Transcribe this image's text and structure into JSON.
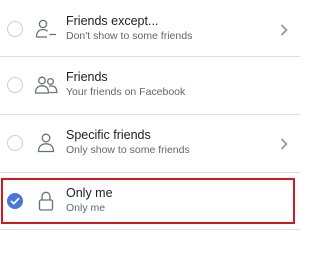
{
  "options": [
    {
      "title": "Friends except...",
      "subtitle": "Don't show to some friends",
      "selected": false,
      "icon": "friends-except-icon",
      "has_chevron": true
    },
    {
      "title": "Friends",
      "subtitle": "Your friends on Facebook",
      "selected": false,
      "icon": "friends-icon",
      "has_chevron": false
    },
    {
      "title": "Specific friends",
      "subtitle": "Only show to some friends",
      "selected": false,
      "icon": "specific-friends-icon",
      "has_chevron": true
    },
    {
      "title": "Only me",
      "subtitle": "Only me",
      "selected": true,
      "icon": "lock-icon",
      "has_chevron": false
    }
  ],
  "colors": {
    "accent": "#4a76d8",
    "highlight_border": "#d0191f",
    "divider": "#dcdee3",
    "title": "#1c1e21",
    "subtitle": "#606770"
  }
}
